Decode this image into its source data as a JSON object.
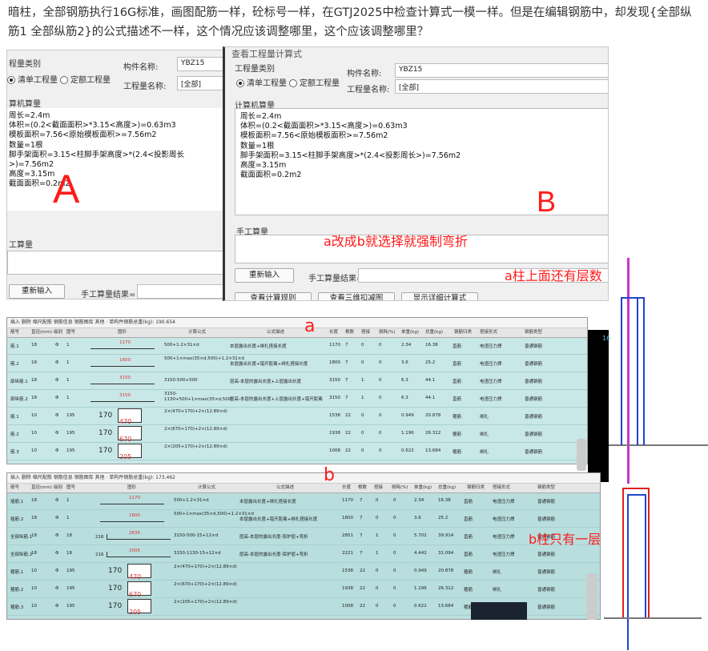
{
  "question": "暗柱，全部钢筋执行16G标准，画图配筋一样，砼标号一样，在GTJ2025中检查计算式一模一样。但是在编辑钢筋中，却发现{全部纵筋1 全部纵筋2}的公式描述不一样，这个情况应该调整哪里，这个应该调整哪里？",
  "panelA": {
    "section_type": "程量类别",
    "radio_list": "清单工程量",
    "radio_quota": "定额工程量",
    "name_label": "构件名称:",
    "name_value": "YBZ15",
    "qty_label": "工程量名称:",
    "qty_value": "[全部]",
    "calc_title": "算机算量",
    "lines": [
      "周长=2.4m",
      "体积=(0.2<截面面积>*3.15<高度>)=0.63m3",
      "模板面积=7.56<原始模板面积>=7.56m2",
      "数量=1根",
      "脚手架面积=3.15<柱脚手架高度>*(2.4<投影周长>)=7.56m2",
      "高度=3.15m",
      "截面面积=0.2m2"
    ],
    "manual_title": "工算量",
    "btn_reinput": "重新输入",
    "manual_result_label": "手工算量结果="
  },
  "panelB": {
    "window_title": "查看工程量计算式",
    "section_type": "工程量类别",
    "radio_list": "清单工程量",
    "radio_quota": "定额工程量",
    "name_label": "构件名称:",
    "name_value": "YBZ15",
    "qty_label": "工程量名称:",
    "qty_value": "[全部]",
    "calc_title": "计算机算量",
    "lines": [
      "周长=2.4m",
      "体积=(0.2<截面面积>*3.15<高度>)=0.63m3",
      "模板面积=7.56<原始模板面积>=7.56m2",
      "数量=1根",
      "脚手架面积=3.15<柱脚手架高度>*(2.4<投影周长>)=7.56m2",
      "高度=3.15m",
      "截面面积=0.2m2"
    ],
    "manual_title": "手工算量",
    "btn_reinput": "重新输入",
    "manual_result_label": "手工算量结果=",
    "btn_view_formula": "查看计算规则",
    "btn_view_3d": "查看三维扣减图",
    "btn_show_detail": "显示详细计算式"
  },
  "annotations": {
    "A": "A",
    "B": "B",
    "a_to_b": "a改成b就选择就强制弯折",
    "a_floors": "a柱上面还有层数",
    "a": "a",
    "b": "b",
    "b_one_floor": "b柱只有一层"
  },
  "gridA": {
    "toolbar": "插入   删除   缩尺配筋   钢筋信息   钢筋图库   其他 ·   单构件钢筋总重(kg): 190.654",
    "headers": [
      "筋号",
      "直径(mm)",
      "级别",
      "图号",
      "图形",
      "计算公式",
      "公式描述",
      "长度",
      "根数",
      "搭接",
      "损耗(%)",
      "单重(kg)",
      "总重(kg)",
      "钢筋归类",
      "搭接形式",
      "钢筋类型"
    ],
    "rows": [
      {
        "name": "筋.1",
        "dia": "18",
        "grade": "Φ",
        "fig": "1",
        "shape": "1170",
        "formula": "500+1.2×31×d",
        "desc": "本层露出长度+绑扎搭接长度",
        "len": "1170",
        "num": "7",
        "lap": "0",
        "loss": "0",
        "uw": "2.34",
        "tw": "16.38",
        "cls": "直筋",
        "lapf": "电渣压力焊",
        "type": "普通钢筋"
      },
      {
        "name": "筋.2",
        "dia": "18",
        "grade": "Φ",
        "fig": "1",
        "shape": "1800",
        "formula": "500+1×max(35×d,500)+1.2×31×d",
        "desc": "本层露出长度+错开距离+绑扎搭接长度",
        "len": "1800",
        "num": "7",
        "lap": "0",
        "loss": "0",
        "uw": "3.6",
        "tw": "25.2",
        "cls": "直筋",
        "lapf": "电渣压力焊",
        "type": "普通钢筋"
      },
      {
        "name": "部纵筋.1",
        "dia": "18",
        "grade": "Φ",
        "fig": "1",
        "shape": "3150",
        "formula": "3150-500+500",
        "desc": "层高-本层的露出长度+上层露出长度",
        "len": "3150",
        "num": "7",
        "lap": "1",
        "loss": "0",
        "uw": "6.3",
        "tw": "44.1",
        "cls": "直筋",
        "lapf": "电渣压力焊",
        "type": "普通钢筋"
      },
      {
        "name": "部纵筋.2",
        "dia": "18",
        "grade": "Φ",
        "fig": "1",
        "shape": "3150",
        "formula": "3150-1130+500+1×max(35×d,500)",
        "desc": "层高-本层的露出长度+上层露出长度+错开距离",
        "len": "3150",
        "num": "7",
        "lap": "1",
        "loss": "0",
        "uw": "6.3",
        "tw": "44.1",
        "cls": "直筋",
        "lapf": "电渣压力焊",
        "type": "普通钢筋"
      },
      {
        "name": "筋.1",
        "dia": "10",
        "grade": "Φ",
        "fig": "195",
        "shape": "470",
        "formula": "2×(470+170)+2×(12.89×d)",
        "desc": "",
        "len": "1538",
        "num": "22",
        "lap": "0",
        "loss": "0",
        "uw": "0.949",
        "tw": "20.878",
        "cls": "箍筋",
        "lapf": "绑扎",
        "type": "普通钢筋"
      },
      {
        "name": "筋.2",
        "dia": "10",
        "grade": "Φ",
        "fig": "195",
        "shape": "670",
        "formula": "2×(670+170)+2×(12.89×d)",
        "desc": "",
        "len": "1938",
        "num": "22",
        "lap": "0",
        "loss": "0",
        "uw": "1.196",
        "tw": "26.312",
        "cls": "箍筋",
        "lapf": "绑扎",
        "type": "普通钢筋"
      },
      {
        "name": "筋.3",
        "dia": "10",
        "grade": "Φ",
        "fig": "195",
        "shape": "205",
        "formula": "2×(205+170)+2×(12.89×d)",
        "desc": "",
        "len": "1008",
        "num": "22",
        "lap": "0",
        "loss": "0",
        "uw": "0.622",
        "tw": "13.684",
        "cls": "箍筋",
        "lapf": "绑扎",
        "type": "普通钢筋"
      }
    ],
    "stirrup_label": "170"
  },
  "gridB": {
    "toolbar": "插入   删除   缩尺配筋   钢筋信息   钢筋图库   其他 ·   单构件钢筋总重(kg): 173.462",
    "headers": [
      "筋号",
      "直径(mm)",
      "级别",
      "图号",
      "图形",
      "计算公式",
      "公式描述",
      "长度",
      "根数",
      "搭接",
      "损耗(%)",
      "单重(kg)",
      "总重(kg)",
      "钢筋归类",
      "搭接形式",
      "钢筋类型"
    ],
    "rows": [
      {
        "name": "插筋.1",
        "dia": "18",
        "grade": "Φ",
        "fig": "1",
        "shape": "1170",
        "formula": "500+1.2×31×d",
        "desc": "本层露出长度+绑扎搭接长度",
        "len": "1170",
        "num": "7",
        "lap": "0",
        "loss": "0",
        "uw": "2.34",
        "tw": "16.38",
        "cls": "直筋",
        "lapf": "电渣压力焊",
        "type": "普通钢筋"
      },
      {
        "name": "插筋.2",
        "dia": "18",
        "grade": "Φ",
        "fig": "1",
        "shape": "1800",
        "formula": "500+1×max(35×d,500)+1.2×31×d",
        "desc": "本层露出长度+错开距离+绑扎搭接长度",
        "len": "1800",
        "num": "7",
        "lap": "0",
        "loss": "0",
        "uw": "3.6",
        "tw": "25.2",
        "cls": "直筋",
        "lapf": "电渣压力焊",
        "type": "普通钢筋"
      },
      {
        "name": "全部纵筋.1",
        "dia": "18",
        "grade": "Φ",
        "fig": "18",
        "shape": "2635",
        "bend": "216",
        "formula": "3150-500-15+12×d",
        "desc": "层高-本层的露出长度-保护层+弯折",
        "len": "2851",
        "num": "7",
        "lap": "1",
        "loss": "0",
        "uw": "5.702",
        "tw": "39.914",
        "cls": "直筋",
        "lapf": "电渣压力焊",
        "type": "普通钢筋"
      },
      {
        "name": "全部纵筋.2",
        "dia": "18",
        "grade": "Φ",
        "fig": "18",
        "shape": "2005",
        "bend": "216",
        "formula": "3150-1130-15+12×d",
        "desc": "层高-本层的露出长度-保护层+弯折",
        "len": "2221",
        "num": "7",
        "lap": "1",
        "loss": "0",
        "uw": "4.442",
        "tw": "31.094",
        "cls": "直筋",
        "lapf": "电渣压力焊",
        "type": "普通钢筋"
      },
      {
        "name": "箍筋.1",
        "dia": "10",
        "grade": "Φ",
        "fig": "195",
        "shape": "470",
        "formula": "2×(470+170)+2×(12.89×d)",
        "desc": "",
        "len": "1538",
        "num": "22",
        "lap": "0",
        "loss": "0",
        "uw": "0.949",
        "tw": "20.878",
        "cls": "箍筋",
        "lapf": "绑扎",
        "type": "普通钢筋"
      },
      {
        "name": "箍筋.2",
        "dia": "10",
        "grade": "Φ",
        "fig": "195",
        "shape": "670",
        "formula": "2×(670+170)+2×(12.89×d)",
        "desc": "",
        "len": "1938",
        "num": "22",
        "lap": "0",
        "loss": "0",
        "uw": "1.196",
        "tw": "26.312",
        "cls": "箍筋",
        "lapf": "绑扎",
        "type": "普通钢筋"
      },
      {
        "name": "箍筋.3",
        "dia": "10",
        "grade": "Φ",
        "fig": "195",
        "shape": "205",
        "formula": "2×(205+170)+2×(12.89×d)",
        "desc": "",
        "len": "1008",
        "num": "22",
        "lap": "0",
        "loss": "0",
        "uw": "0.622",
        "tw": "13.684",
        "cls": "箍筋",
        "lapf": "绑扎",
        "type": "普通钢筋"
      }
    ],
    "stirrup_label": "170"
  },
  "cad_label": "16",
  "colors": {
    "red": "#ff1a1a",
    "magenta": "#cc33cc",
    "blue": "#2244cc",
    "grid_bg": "#c8e7e7"
  }
}
